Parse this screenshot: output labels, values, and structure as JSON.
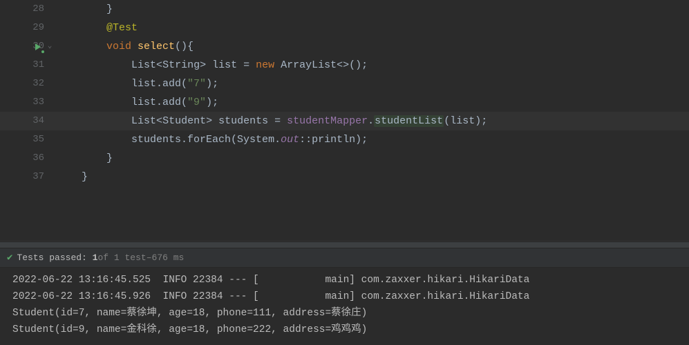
{
  "editor": {
    "lines": [
      {
        "num": "28",
        "highlighted": false,
        "gutter_run": false,
        "gutter_fold": false,
        "tokens": [
          {
            "t": "        }",
            "c": "punct"
          }
        ]
      },
      {
        "num": "29",
        "highlighted": false,
        "gutter_run": false,
        "gutter_fold": false,
        "tokens": [
          {
            "t": "        ",
            "c": "punct"
          },
          {
            "t": "@Test",
            "c": "ann"
          }
        ]
      },
      {
        "num": "30",
        "highlighted": false,
        "gutter_run": true,
        "gutter_fold": true,
        "tokens": [
          {
            "t": "        ",
            "c": "punct"
          },
          {
            "t": "void ",
            "c": "kw"
          },
          {
            "t": "select",
            "c": "mname"
          },
          {
            "t": "(){",
            "c": "punct"
          }
        ]
      },
      {
        "num": "31",
        "highlighted": false,
        "gutter_run": false,
        "gutter_fold": false,
        "tokens": [
          {
            "t": "            ",
            "c": "punct"
          },
          {
            "t": "List",
            "c": "type"
          },
          {
            "t": "<",
            "c": "generic"
          },
          {
            "t": "String",
            "c": "type"
          },
          {
            "t": ">",
            "c": "generic"
          },
          {
            "t": " list = ",
            "c": "punct"
          },
          {
            "t": "new ",
            "c": "kw"
          },
          {
            "t": "ArrayList",
            "c": "type"
          },
          {
            "t": "<>();",
            "c": "punct"
          }
        ]
      },
      {
        "num": "32",
        "highlighted": false,
        "gutter_run": false,
        "gutter_fold": false,
        "tokens": [
          {
            "t": "            ",
            "c": "punct"
          },
          {
            "t": "list.add(",
            "c": "method-call"
          },
          {
            "t": "\"7\"",
            "c": "str"
          },
          {
            "t": ");",
            "c": "punct"
          }
        ]
      },
      {
        "num": "33",
        "highlighted": false,
        "gutter_run": false,
        "gutter_fold": false,
        "tokens": [
          {
            "t": "            ",
            "c": "punct"
          },
          {
            "t": "list.add(",
            "c": "method-call"
          },
          {
            "t": "\"9\"",
            "c": "str"
          },
          {
            "t": ");",
            "c": "punct"
          }
        ]
      },
      {
        "num": "34",
        "highlighted": true,
        "gutter_run": false,
        "gutter_fold": false,
        "tokens": [
          {
            "t": "            ",
            "c": "punct"
          },
          {
            "t": "List",
            "c": "type"
          },
          {
            "t": "<",
            "c": "generic"
          },
          {
            "t": "Student",
            "c": "type"
          },
          {
            "t": ">",
            "c": "generic"
          },
          {
            "t": " students = ",
            "c": "punct"
          },
          {
            "t": "studentMapper",
            "c": "field"
          },
          {
            "t": ".",
            "c": "punct"
          },
          {
            "t": "studentList",
            "c": "method-hi"
          },
          {
            "t": "(list);",
            "c": "punct"
          }
        ]
      },
      {
        "num": "35",
        "highlighted": false,
        "gutter_run": false,
        "gutter_fold": false,
        "tokens": [
          {
            "t": "            ",
            "c": "punct"
          },
          {
            "t": "students.forEach(System.",
            "c": "method-call"
          },
          {
            "t": "out",
            "c": "static-field"
          },
          {
            "t": "::println);",
            "c": "method-call"
          }
        ]
      },
      {
        "num": "36",
        "highlighted": false,
        "gutter_run": false,
        "gutter_fold": false,
        "tokens": [
          {
            "t": "        }",
            "c": "punct"
          }
        ]
      },
      {
        "num": "37",
        "highlighted": false,
        "gutter_run": false,
        "gutter_fold": false,
        "tokens": [
          {
            "t": "    }",
            "c": "punct"
          }
        ]
      }
    ]
  },
  "tests_bar": {
    "passed_label": "Tests passed:",
    "passed_count": "1",
    "of_part": " of 1 test",
    "time_sep": " – ",
    "time": "676 ms"
  },
  "console": {
    "lines": [
      "2022-06-22 13:16:45.525  INFO 22384 --- [           main] com.zaxxer.hikari.HikariData",
      "2022-06-22 13:16:45.926  INFO 22384 --- [           main] com.zaxxer.hikari.HikariData",
      "Student(id=7, name=蔡徐坤, age=18, phone=111, address=蔡徐庄)",
      "Student(id=9, name=金科徐, age=18, phone=222, address=鸡鸡鸡)"
    ]
  }
}
